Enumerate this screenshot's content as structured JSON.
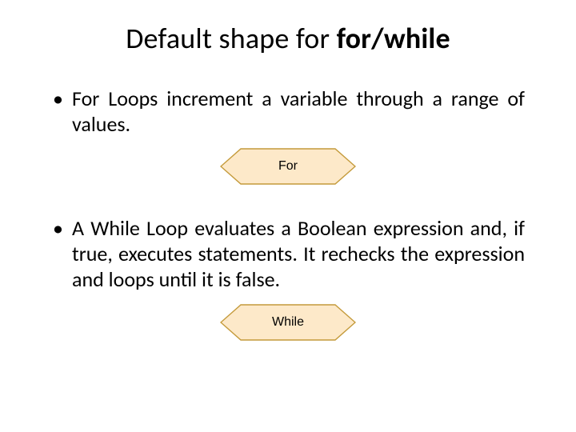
{
  "title": {
    "prefix": "Default shape for ",
    "bold": "for/while"
  },
  "bullets": {
    "for_text": "For Loops increment a variable through a range of values.",
    "while_text": "A While Loop evaluates a Boolean expression and, if true, executes statements. It rechecks the expression and loops until it is false."
  },
  "shapes": {
    "for_label": "For",
    "while_label": "While",
    "fill": "#fde9c9",
    "stroke": "#c49a3a"
  }
}
